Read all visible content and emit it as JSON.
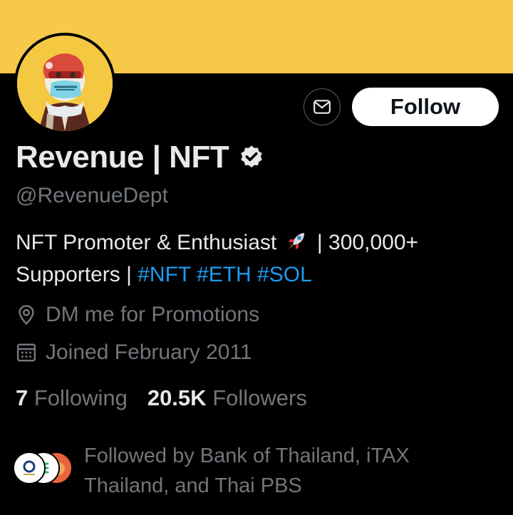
{
  "profile": {
    "name": "Revenue | NFT",
    "handle": "@RevenueDept",
    "bio": {
      "part1": "NFT Promoter & Enthusiast",
      "part2": " | 300,000+ Supporters | ",
      "tags": [
        "#NFT",
        "#ETH",
        "#SOL"
      ]
    },
    "location": "DM me for Promotions",
    "joined": "Joined February 2011",
    "following_count": "7",
    "following_label": "Following",
    "followers_count": "20.5K",
    "followers_label": "Followers"
  },
  "actions": {
    "follow_label": "Follow"
  },
  "followed_by": {
    "text": "Followed by Bank of Thailand, iTAX Thailand, and Thai PBS"
  },
  "icons": {
    "message": "envelope-icon",
    "verified": "verified-badge-icon",
    "location": "location-pin-icon",
    "joined": "calendar-icon",
    "rocket": "rocket-emoji"
  },
  "colors": {
    "banner": "#f7c948",
    "background": "#000000",
    "link": "#1d9bf0",
    "muted": "#71767b",
    "text": "#e7e9ea"
  }
}
